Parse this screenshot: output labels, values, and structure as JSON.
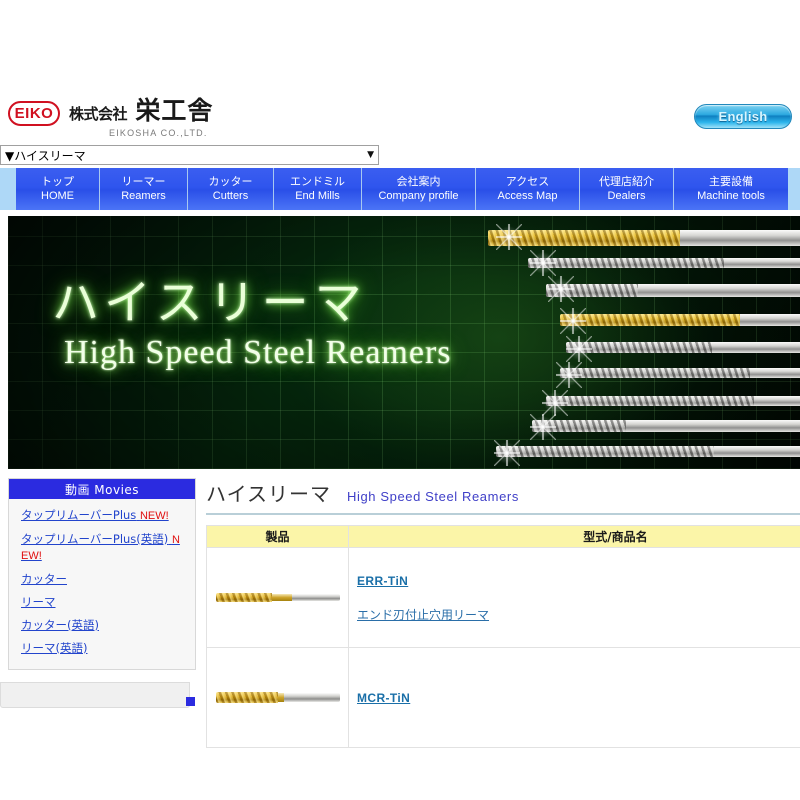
{
  "header": {
    "logo_badge": "EIKO",
    "company_jp_small": "株式会社",
    "company_jp_big": "栄工舎",
    "company_en": "EIKOSHA CO.,LTD.",
    "english_button": "English"
  },
  "page_select": {
    "selected_value": "▼ハイスリーマ",
    "arrow": "▼"
  },
  "nav": {
    "items": [
      {
        "jp": "トップ",
        "en": "HOME",
        "cls": "nav-w-home",
        "name": "nav-item-home"
      },
      {
        "jp": "リーマー",
        "en": "Reamers",
        "cls": "nav-w-reamers",
        "name": "nav-item-reamers"
      },
      {
        "jp": "カッター",
        "en": "Cutters",
        "cls": "nav-w-cutters",
        "name": "nav-item-cutters"
      },
      {
        "jp": "エンドミル",
        "en": "End Mills",
        "cls": "nav-w-endmill",
        "name": "nav-item-end-mills"
      },
      {
        "jp": "会社案内",
        "en": "Company profile",
        "cls": "nav-w-company",
        "name": "nav-item-company-profile"
      },
      {
        "jp": "アクセス",
        "en": "Access Map",
        "cls": "nav-w-access",
        "name": "nav-item-access-map"
      },
      {
        "jp": "代理店紹介",
        "en": "Dealers",
        "cls": "nav-w-dealers",
        "name": "nav-item-dealers"
      },
      {
        "jp": "主要設備",
        "en": "Machine tools",
        "cls": "nav-w-machine",
        "name": "nav-item-machine-tools"
      }
    ]
  },
  "banner": {
    "title_jp": "ハイスリーマ",
    "title_en": "High Speed Steel Reamers"
  },
  "sidebar": {
    "heading": "動画 Movies",
    "links": [
      {
        "text": "タップリムーバーPlus",
        "badge": "NEW!",
        "name": "sidebar-link-tap-remover-plus"
      },
      {
        "text": "タップリムーバーPlus(英語)",
        "badge": "NEW!",
        "name": "sidebar-link-tap-remover-plus-en"
      },
      {
        "text": "カッター",
        "badge": "",
        "name": "sidebar-link-cutter"
      },
      {
        "text": "リーマ",
        "badge": "",
        "name": "sidebar-link-reamer"
      },
      {
        "text": "カッター(英語)",
        "badge": "",
        "name": "sidebar-link-cutter-en"
      },
      {
        "text": "リーマ(英語)",
        "badge": "",
        "name": "sidebar-link-reamer-en"
      }
    ]
  },
  "main": {
    "title_jp": "ハイスリーマ",
    "title_en": "High Speed Steel Reamers",
    "table": {
      "headers": [
        "製品",
        "型式/商品名"
      ],
      "rows": [
        {
          "image_name": "product-image-err-tin",
          "model": "ERR-TiN",
          "description": "エンド刃付止穴用リーマ",
          "thumb_class": "thumb"
        },
        {
          "image_name": "product-image-mcr-tin",
          "model": "MCR-TiN",
          "description": "",
          "thumb_class": "thumb mcr"
        }
      ]
    }
  },
  "colors": {
    "nav_blue": "#2f55ee",
    "nav_strip": "#aed8f7",
    "sidebar_head": "#2b2be0",
    "table_header": "#fbf5a8",
    "link_blue": "#2244cc",
    "product_link": "#1a6fa8",
    "new_badge_red": "#e01010",
    "title_rule": "#b9cfd8",
    "logo_red": "#d01020"
  }
}
